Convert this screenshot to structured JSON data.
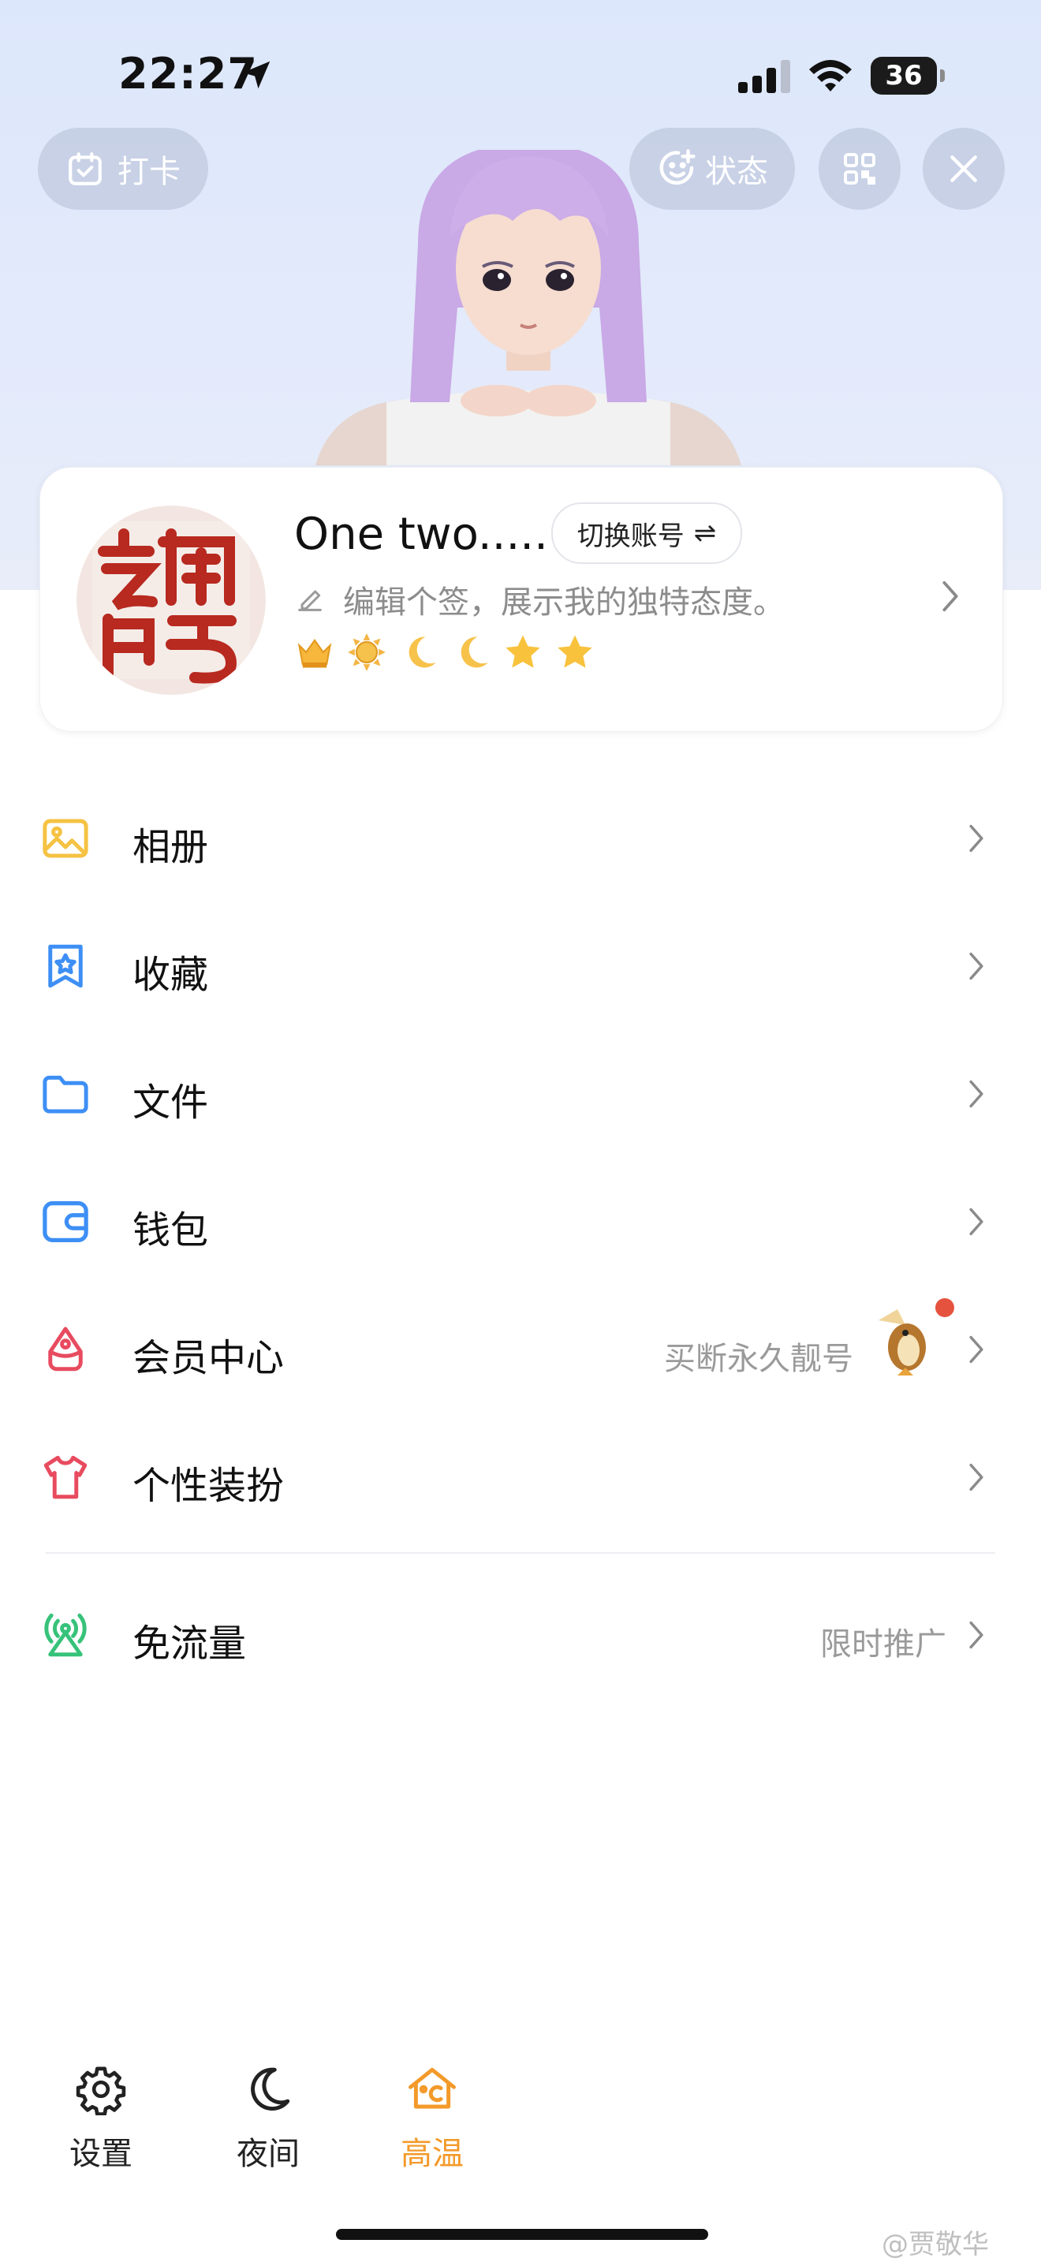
{
  "status_bar": {
    "time": "22:27",
    "battery": "36"
  },
  "header": {
    "checkin_label": "打卡",
    "status_label": "状态"
  },
  "profile": {
    "seal_text": "之網印亏",
    "username": "One two.....",
    "switch_account": "切换账号",
    "switch_icon": "⇌",
    "signature_placeholder": "编辑个签，展示我的独特态度。",
    "badges": [
      "crown-icon",
      "sun-icon",
      "moon-icon",
      "moon-icon",
      "star-icon",
      "star-icon"
    ]
  },
  "menu": {
    "items": [
      {
        "label": "相册",
        "icon": "photo-icon"
      },
      {
        "label": "收藏",
        "icon": "bookmark-star-icon"
      },
      {
        "label": "文件",
        "icon": "folder-icon"
      },
      {
        "label": "钱包",
        "icon": "wallet-icon"
      },
      {
        "label": "会员中心",
        "icon": "vip-icon",
        "hint": "买断永久靓号"
      },
      {
        "label": "个性装扮",
        "icon": "tshirt-icon"
      },
      {
        "label": "免流量",
        "icon": "signal-tower-icon",
        "hint": "限时推广"
      }
    ]
  },
  "bottom_bar": {
    "settings": "设置",
    "night": "夜间",
    "hot": "高温"
  },
  "watermark": "@贾敬华",
  "colors": {
    "accent_orange": "#f39a2a",
    "photo": "#f5c242",
    "blue": "#3d8ff5",
    "red": "#e84b5f",
    "green": "#37c27a"
  }
}
